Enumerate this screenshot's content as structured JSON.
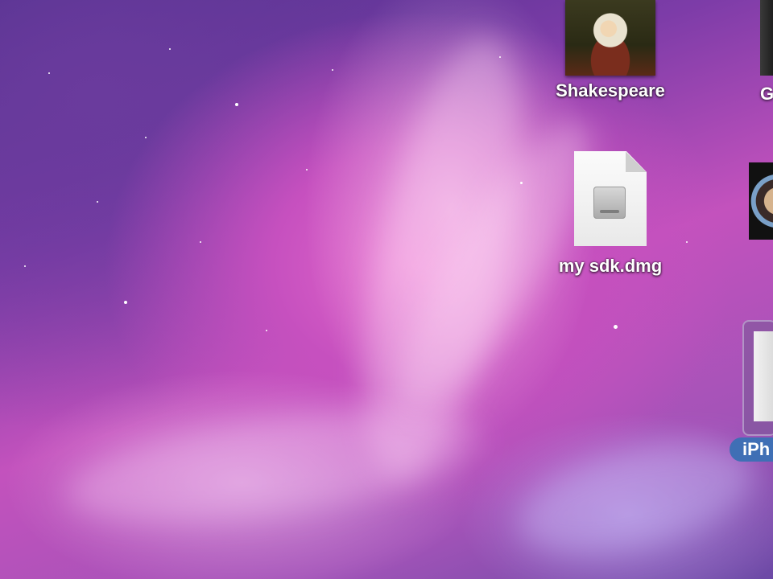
{
  "desktop": {
    "icons": [
      {
        "label": "Shakespeare",
        "icon": "portrait-image-icon"
      },
      {
        "label": "my sdk.dmg",
        "icon": "disk-image-file-icon"
      }
    ],
    "partial_icons": [
      {
        "label": "G",
        "icon": "image-thumbnail-icon"
      },
      {
        "label": "",
        "icon": "app-icon"
      },
      {
        "label": "iPh",
        "icon": "iphone-device-icon",
        "selected": true
      }
    ]
  },
  "colors": {
    "selection_label": "#3f6fb5",
    "wallpaper_pink": "#e569cc",
    "wallpaper_purple": "#6a3b9d"
  }
}
